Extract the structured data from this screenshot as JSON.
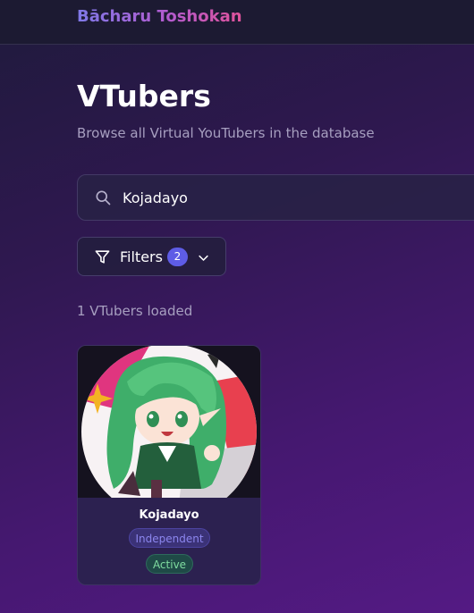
{
  "header": {
    "brand": "Bācharu Toshokan"
  },
  "page": {
    "title": "VTubers",
    "subtitle": "Browse all Virtual YouTubers in the database"
  },
  "search": {
    "value": "Kojadayo",
    "icon": "search-icon"
  },
  "filters": {
    "label": "Filters",
    "active_count": "2",
    "icon": "filter-icon",
    "toggle_icon": "chevron-down-icon"
  },
  "results": {
    "loaded_text": "1 VTubers loaded"
  },
  "vtubers": [
    {
      "name": "Kojadayo",
      "affiliation": "Independent",
      "status": "Active"
    }
  ],
  "colors": {
    "accent": "#5e5ce6",
    "brand_start": "#7f79e8",
    "brand_end": "#e0539b",
    "status_active": "#7fdca0"
  }
}
